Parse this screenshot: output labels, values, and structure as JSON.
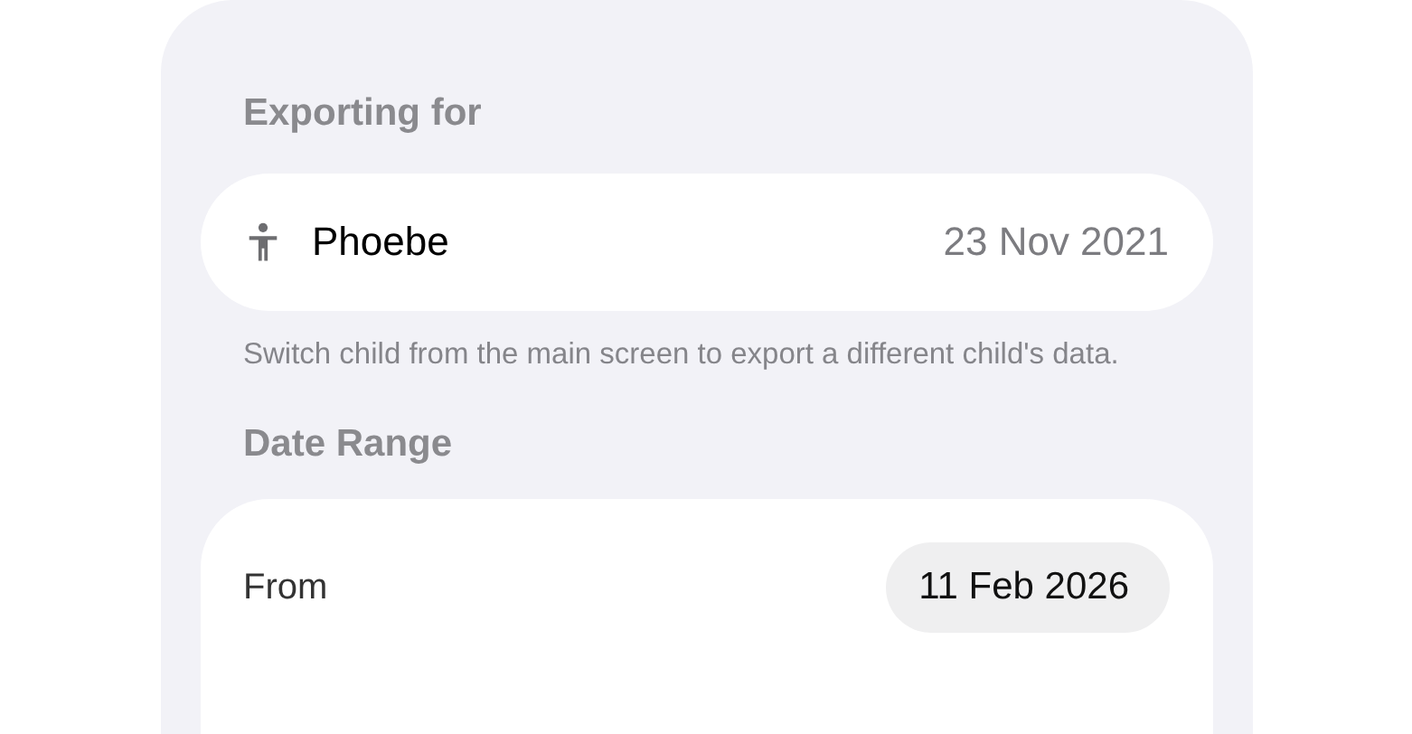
{
  "exporting_section": {
    "header": "Exporting for",
    "child": {
      "name": "Phoebe",
      "birth_date": "23 Nov 2021"
    },
    "footer": "Switch child from the main screen to export a different child's data."
  },
  "date_range_section": {
    "header": "Date Range",
    "rows": [
      {
        "label": "From",
        "value": "11 Feb 2026"
      }
    ]
  }
}
